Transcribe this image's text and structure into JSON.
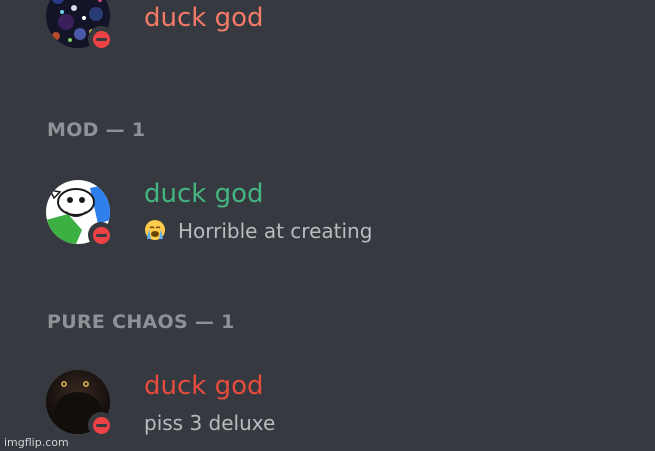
{
  "members_top": {
    "name": "duck god",
    "name_color": "#f47b67"
  },
  "sections": [
    {
      "header": "MOD — 1",
      "member": {
        "name": "duck god",
        "name_color": "#43b581",
        "activity": "Horrible at creating",
        "activity_emoji": "loudly-crying-face-emoji"
      }
    },
    {
      "header": "PURE CHAOS — 1",
      "member": {
        "name": "duck god",
        "name_color": "#e74c3c",
        "activity": "piss 3 deluxe"
      }
    }
  ],
  "status": "do-not-disturb",
  "watermark": "imgflip.com"
}
